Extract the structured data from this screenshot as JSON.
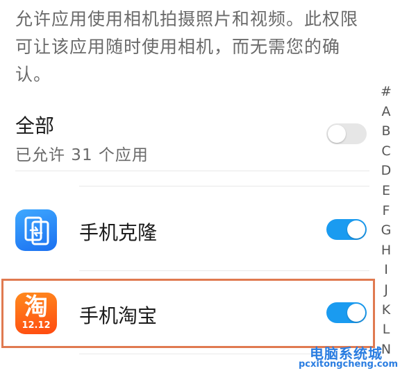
{
  "description": "允许应用使用相机拍摄照片和视频。此权限可让该应用随时使用相机，而无需您的确认。",
  "all_section": {
    "title": "全部",
    "subtitle": "已允许 31 个应用",
    "toggle_state": "off"
  },
  "apps": [
    {
      "name": "手机克隆",
      "icon": "phone-clone-icon",
      "toggle_state": "on"
    },
    {
      "name": "手机淘宝",
      "icon": "taobao-icon",
      "icon_text": "淘",
      "icon_badge": "12.12",
      "toggle_state": "on"
    }
  ],
  "alpha_index": [
    "#",
    "A",
    "B",
    "C",
    "D",
    "E",
    "F",
    "G",
    "H",
    "I",
    "J",
    "K",
    "L",
    "N"
  ],
  "colors": {
    "toggle_on": "#1a9bf0",
    "toggle_off": "#e6e6e6",
    "highlight_border": "#e07a50"
  },
  "watermark": {
    "title": "电脑系统城",
    "url": "pcxitongcheng.com"
  }
}
